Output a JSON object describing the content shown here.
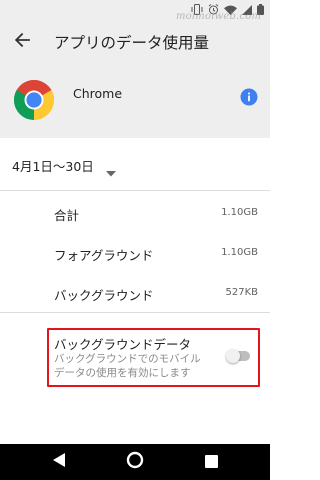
{
  "status_bar": {
    "icons": [
      "vibrate-icon",
      "alarm-icon",
      "wifi-icon",
      "signal-icon",
      "battery-icon"
    ],
    "watermark": "moimoiweb.com"
  },
  "toolbar": {
    "back_icon": "arrow-back-icon",
    "title": "アプリのデータ使用量"
  },
  "app": {
    "name": "Chrome",
    "icon": "chrome-logo",
    "info_icon": "info-icon",
    "accent_color": "#3f7ff0"
  },
  "date_range": {
    "label": "4月1日〜30日",
    "dropdown_icon": "dropdown-arrow-icon"
  },
  "usage": {
    "rows": [
      {
        "label": "合計",
        "value": "1.10GB"
      },
      {
        "label": "フォアグラウンド",
        "value": "1.10GB"
      },
      {
        "label": "バックグラウンド",
        "value": "527KB"
      }
    ]
  },
  "background_data": {
    "title": "バックグラウンドデータ",
    "summary": "バックグラウンドでのモバイル データの使用を有効にします",
    "enabled": false,
    "highlight_color": "#e0161c"
  },
  "nav_bar": {
    "icons": [
      "back-triangle-icon",
      "home-circle-icon",
      "recents-square-icon"
    ]
  }
}
